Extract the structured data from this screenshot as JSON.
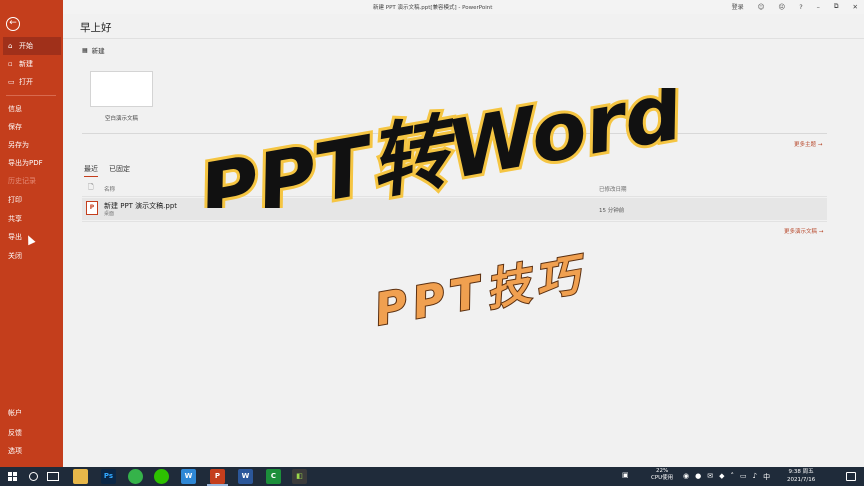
{
  "window": {
    "title": "新建 PPT 演示文稿.ppt[兼容模式]  -  PowerPoint",
    "sign_in": "登录",
    "help": "?",
    "minimize": "–",
    "restore": "⧉",
    "close": "✕"
  },
  "sidebar": {
    "back": "←",
    "items": [
      {
        "label": "开始",
        "icon": "⌂"
      },
      {
        "label": "新建",
        "icon": "▫"
      },
      {
        "label": "打开",
        "icon": "▭"
      },
      {
        "label": "信息"
      },
      {
        "label": "保存"
      },
      {
        "label": "另存为"
      },
      {
        "label": "导出为PDF"
      },
      {
        "label": "历史记录"
      },
      {
        "label": "打印"
      },
      {
        "label": "共享"
      },
      {
        "label": "导出"
      },
      {
        "label": "关闭"
      },
      {
        "label": "帐户"
      },
      {
        "label": "反馈"
      },
      {
        "label": "选项"
      }
    ]
  },
  "main": {
    "greeting": "早上好",
    "new_section": "新建",
    "blank_label": "空白演示文稿",
    "more_themes": "更多主题",
    "tabs": [
      "最近",
      "已固定"
    ],
    "list_header": {
      "name": "名称",
      "date": "已修改日期"
    },
    "files": [
      {
        "name": "新建 PPT 演示文稿.ppt",
        "location": "桌面",
        "time": "15 分钟前"
      }
    ],
    "more_presentations": "更多演示文稿"
  },
  "overlay": {
    "headline": "PPT转Word",
    "subtitle": "PPT技巧",
    "headline_color": "#111111",
    "headline_stroke": "#f5c542",
    "subtitle_color": "#f0a050"
  },
  "taskbar": {
    "apps": [
      "Ps",
      "",
      "",
      "W",
      "P",
      "W",
      "C",
      ""
    ],
    "cpu_percent": "22%",
    "cpu_label": "CPU使用",
    "time": "9:38 周五",
    "date": "2021/7/16"
  },
  "colors": {
    "accent": "#c43e1c",
    "taskbar": "#1f2b3a"
  }
}
